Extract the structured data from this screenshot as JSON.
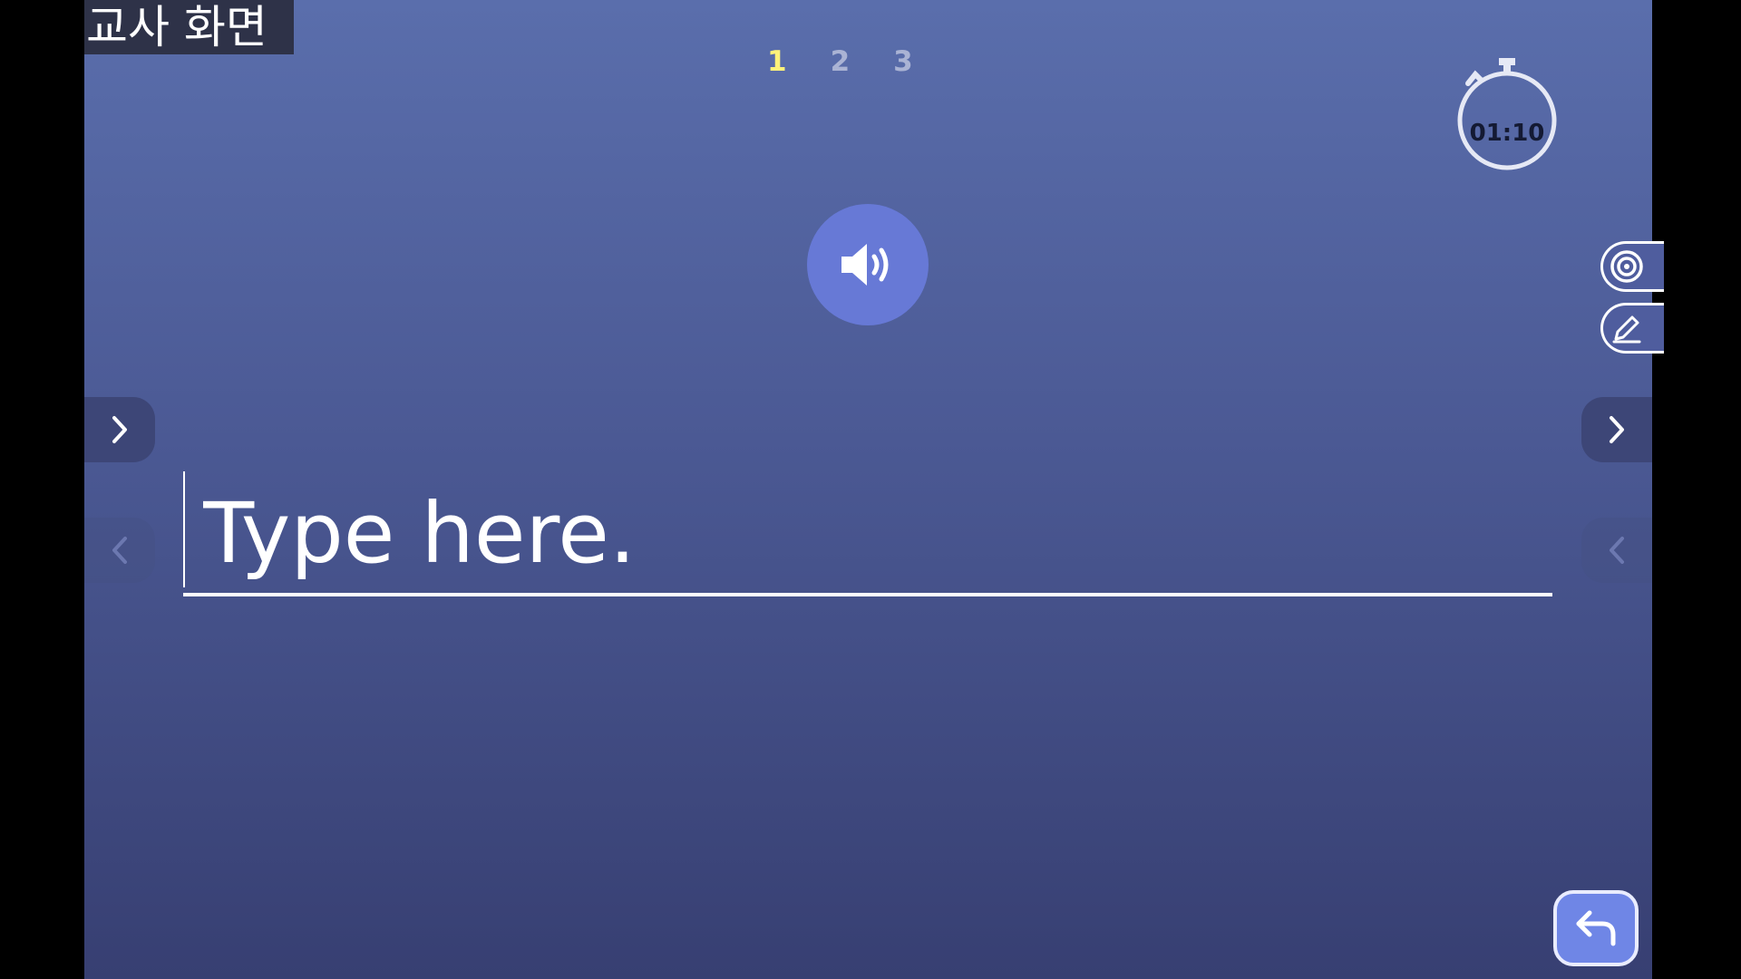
{
  "overlay": {
    "label": "교사 화면"
  },
  "pager": {
    "pages": [
      "1",
      "2",
      "3"
    ],
    "active": "1"
  },
  "timer": {
    "value": "01:10"
  },
  "input": {
    "placeholder": "Type here.",
    "value": ""
  },
  "icons": {
    "audio": "speaker-icon",
    "target": "target-icon",
    "pen": "pen-icon",
    "next": "chevron-right-icon",
    "prev": "chevron-left-icon",
    "back": "return-arrow-icon",
    "timer": "stopwatch-icon"
  },
  "colors": {
    "accent": "#6779d6",
    "active_page": "#fff27a",
    "inactive_page": "#aab3d4",
    "background_top": "#5a6eac",
    "background_bottom": "#373f72"
  }
}
